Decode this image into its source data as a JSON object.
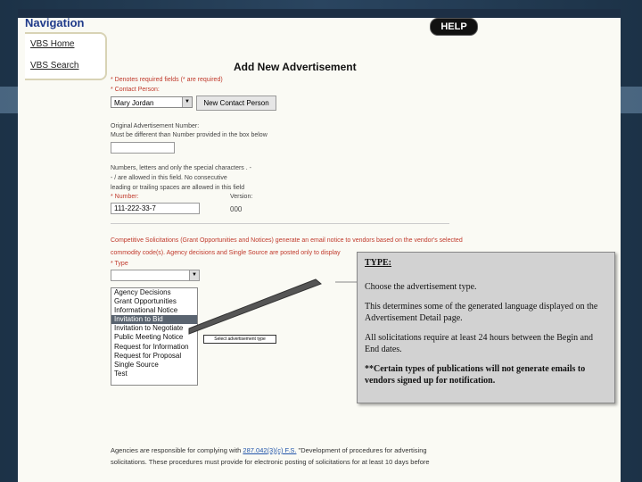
{
  "nav": {
    "title": "Navigation",
    "items": [
      {
        "label": "VBS Home"
      },
      {
        "label": "VBS Search"
      }
    ]
  },
  "help_label": "HELP",
  "page_title": "Add New Advertisement",
  "form": {
    "required_note": "* Denotes required fields (* are required)",
    "contact_label": "* Contact Person:",
    "contact_value": "Mary Jordan",
    "new_contact_button": "New Contact Person",
    "orig_ad_label": "Original Advertisement Number:",
    "orig_ad_note": "Must be different than Number provided in the box below",
    "rules_line1": "Numbers, letters and only the special characters . -",
    "rules_line2": "- / are allowed in this field. No consecutive",
    "rules_line3": "leading or trailing spaces are allowed in this field",
    "number_label": "* Number:",
    "version_label": "Version:",
    "number_value": "111-222-33-7",
    "version_value": "000",
    "competitive_line1": "Competitive Solicitations (Grant Opportunities and Notices) generate an email notice to vendors based on the vendor's selected",
    "competitive_line2": "commodity code(s). Agency decisions and Single Source are posted only to display",
    "type_label": "* Type",
    "type_options": [
      "Agency Decisions",
      "Grant Opportunities",
      "Informational Notice",
      "Invitation to Bid",
      "Invitation to Negotiate",
      "Public Meeting Notice",
      "Request for Information",
      "Request for Proposal",
      "Single Source",
      "Test"
    ],
    "selected_type": "Invitation to Bid",
    "mini_tooltip": "Select advertisement type"
  },
  "callout": {
    "title": "TYPE:",
    "p1": "Choose the advertisement type.",
    "p2": "This determines some of the generated language displayed on the Advertisement Detail page.",
    "p3": "All solicitations require at least 24 hours between the Begin and End dates.",
    "p4": "**Certain types of publications will not generate emails to vendors signed up for notification."
  },
  "footer": {
    "line1_before": "Agencies are responsible for complying with",
    "line1_link": "287.042(3)(c) F.S.",
    "line1_after": "\"Development of procedures for advertising",
    "line2": "solicitations. These procedures must provide for electronic posting of solicitations for at least 10 days before"
  }
}
